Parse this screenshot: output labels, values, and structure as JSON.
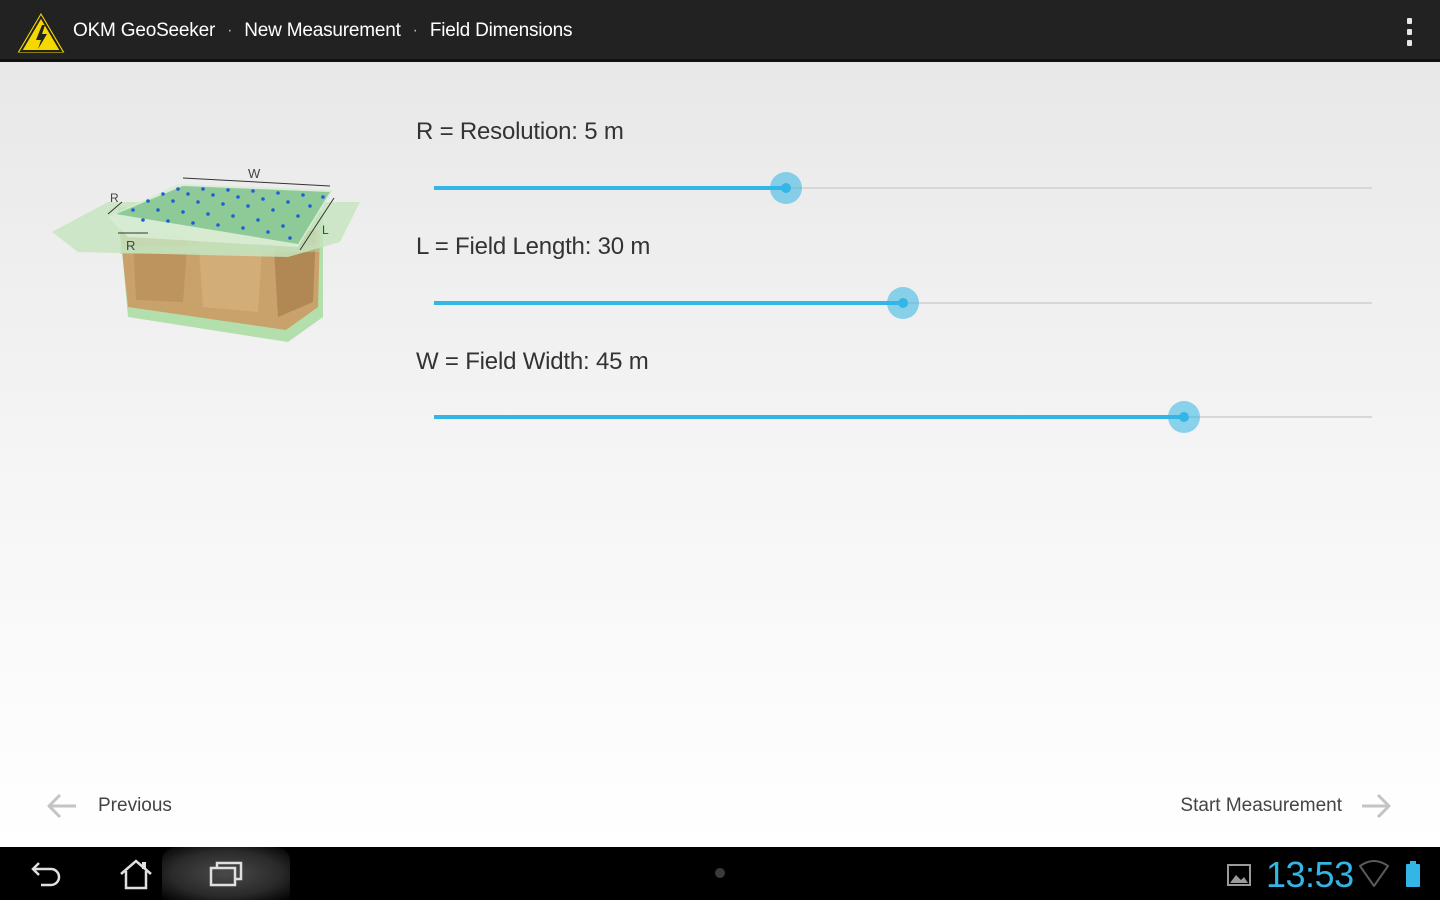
{
  "actionbar": {
    "breadcrumbs": [
      "OKM GeoSeeker",
      "New Measurement",
      "Field Dimensions"
    ],
    "separator": "·",
    "logo_icon": "warning-triangle-icon",
    "overflow_icon": "overflow-menu-icon"
  },
  "illustration": {
    "labels": {
      "w": "W",
      "r_top": "R",
      "r_bottom": "R",
      "l": "L"
    }
  },
  "settings": [
    {
      "label": "R = Resolution: 5 m",
      "level": 0.375
    },
    {
      "label": "L = Field Length: 30 m",
      "level": 0.5
    },
    {
      "label": "W = Field Width: 45 m",
      "level": 0.8
    }
  ],
  "navigation": {
    "previous_label": "Previous",
    "next_label": "Start Measurement"
  },
  "systembar": {
    "clock": "13:53"
  },
  "colors": {
    "accent": "#33b5e5",
    "actionbar": "#222222",
    "systembar": "#000000",
    "warning": "#f5d800"
  }
}
